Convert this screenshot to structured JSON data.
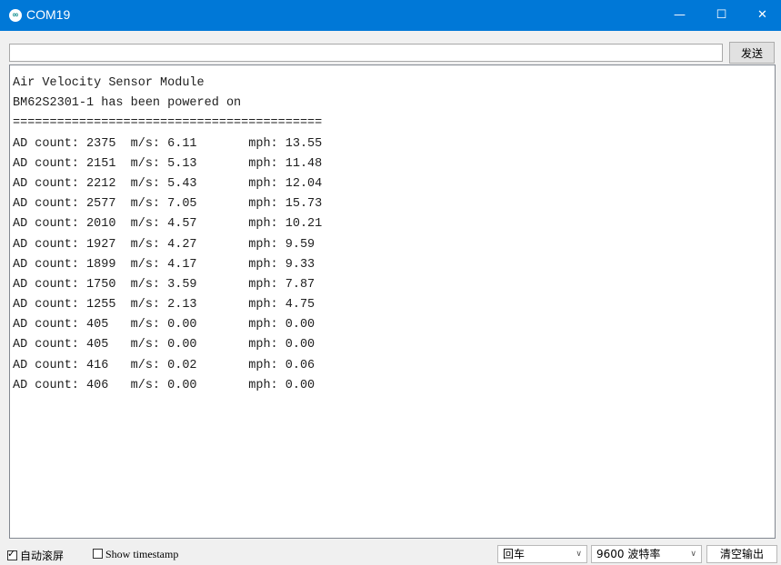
{
  "window": {
    "title": "COM19",
    "icon": "arduino-infinity-icon",
    "minimize_glyph": "—",
    "maximize_glyph": "☐",
    "close_glyph": "✕"
  },
  "send_bar": {
    "input_value": "",
    "send_label": "发送"
  },
  "console": {
    "lines": [
      "Air Velocity Sensor Module",
      "BM62S2301-1 has been powered on",
      "==========================================",
      "AD count: 2375  m/s: 6.11       mph: 13.55",
      "AD count: 2151  m/s: 5.13       mph: 11.48",
      "AD count: 2212  m/s: 5.43       mph: 12.04",
      "AD count: 2577  m/s: 7.05       mph: 15.73",
      "AD count: 2010  m/s: 4.57       mph: 10.21",
      "AD count: 1927  m/s: 4.27       mph: 9.59",
      "AD count: 1899  m/s: 4.17       mph: 9.33",
      "AD count: 1750  m/s: 3.59       mph: 7.87",
      "AD count: 1255  m/s: 2.13       mph: 4.75",
      "AD count: 405   m/s: 0.00       mph: 0.00",
      "AD count: 405   m/s: 0.00       mph: 0.00",
      "AD count: 416   m/s: 0.02       mph: 0.06",
      "AD count: 406   m/s: 0.00       mph: 0.00"
    ]
  },
  "status_bar": {
    "autoscroll": {
      "label": "自动滚屏",
      "checked": true,
      "tick_glyph": "✓"
    },
    "timestamp": {
      "label": "Show timestamp",
      "checked": false
    },
    "line_ending": {
      "selected": "回车",
      "chevron": "∨"
    },
    "baud_rate": {
      "selected": "9600 波特率",
      "chevron": "∨"
    },
    "clear_label": "清空输出"
  },
  "colors": {
    "titlebar": "#0078d7",
    "window_bg": "#f0f0f0",
    "console_bg": "#ffffff",
    "console_text": "#1e1e1e"
  }
}
